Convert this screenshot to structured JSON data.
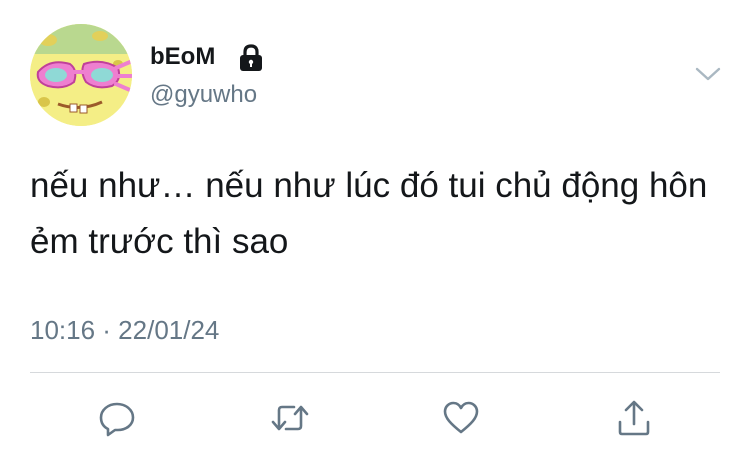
{
  "author": {
    "display_name": "bEoM",
    "handle": "@gyuwho",
    "protected_icon": "lock-icon",
    "avatar_icon": "spongebob-sunglasses-avatar"
  },
  "tweet": {
    "text": "nếu như… nếu như lúc đó tui chủ động hôn ẻm trước thì sao",
    "timestamp": "10:16 · 22/01/24"
  },
  "menu": {
    "icon": "chevron-down-icon"
  },
  "actions": [
    {
      "name": "reply",
      "icon": "speech-bubble-icon"
    },
    {
      "name": "retweet",
      "icon": "retweet-arrows-icon"
    },
    {
      "name": "like",
      "icon": "heart-icon"
    },
    {
      "name": "share",
      "icon": "share-upload-icon"
    }
  ],
  "colors": {
    "text_primary": "#14171a",
    "text_secondary": "#657786",
    "icon_gray": "#657786",
    "divider": "#d6d9dc"
  }
}
